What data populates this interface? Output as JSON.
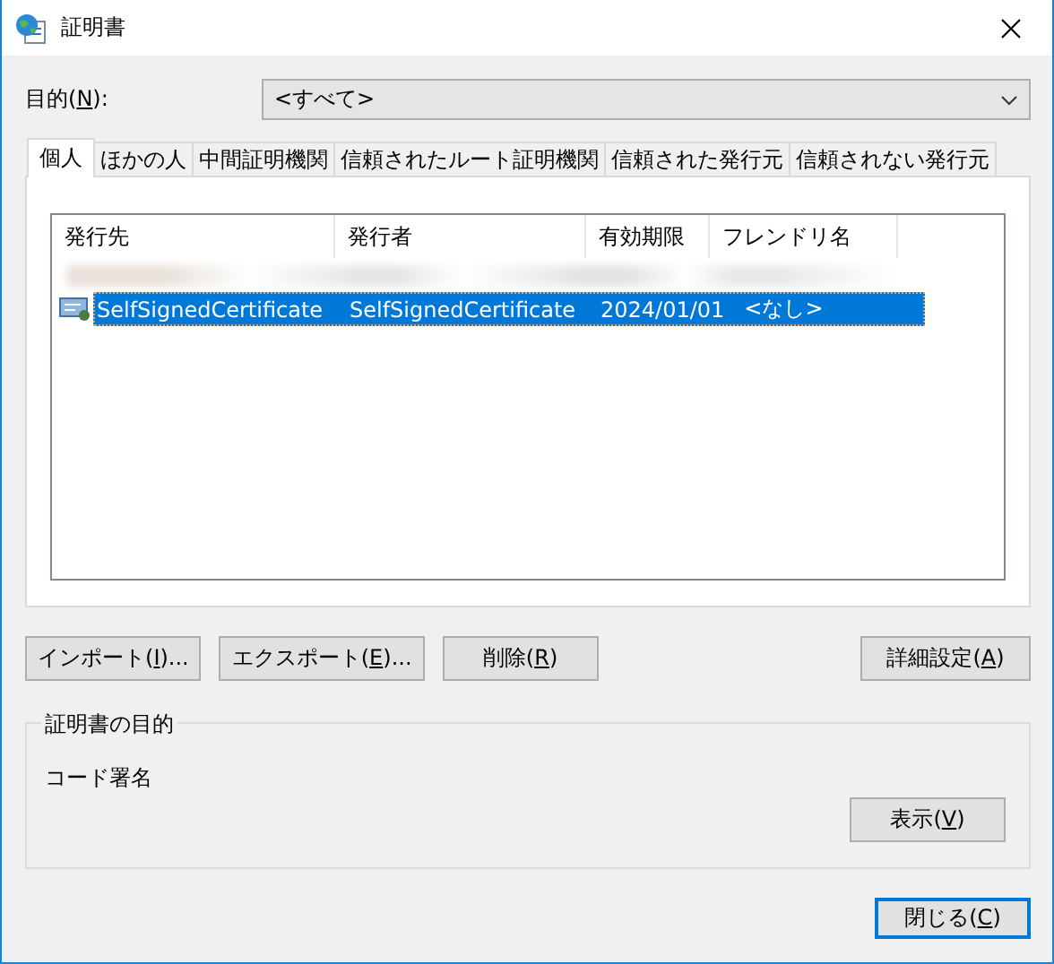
{
  "window": {
    "title": "証明書"
  },
  "purpose": {
    "label": {
      "before": "目的(",
      "accel": "N",
      "after": "):"
    },
    "value": "<すべて>"
  },
  "tabs": [
    {
      "label": "個人",
      "selected": true
    },
    {
      "label": "ほかの人",
      "selected": false
    },
    {
      "label": "中間証明機関",
      "selected": false
    },
    {
      "label": "信頼されたルート証明機関",
      "selected": false
    },
    {
      "label": "信頼された発行元",
      "selected": false
    },
    {
      "label": "信頼されない発行元",
      "selected": false
    }
  ],
  "table": {
    "columns": [
      "発行先",
      "発行者",
      "有効期限",
      "フレンドリ名"
    ],
    "rows": [
      {
        "kind": "blurred",
        "selected": false
      },
      {
        "kind": "cert",
        "selected": true,
        "cells": [
          "SelfSignedCertificate",
          "SelfSignedCertificate",
          "2024/01/01",
          "<なし>"
        ]
      }
    ]
  },
  "actions": [
    {
      "before": "インポート(",
      "accel": "I",
      "after": ")..."
    },
    {
      "before": "エクスポート(",
      "accel": "E",
      "after": ")..."
    },
    {
      "before": "削除(",
      "accel": "R",
      "after": ")"
    }
  ],
  "advanced": {
    "before": "詳細設定(",
    "accel": "A",
    "after": ")"
  },
  "purpose_group": {
    "legend": "証明書の目的",
    "text": "コード署名",
    "view_button": {
      "before": "表示(",
      "accel": "V",
      "after": ")"
    }
  },
  "close_button": {
    "before": "閉じる(",
    "accel": "C",
    "after": ")"
  }
}
